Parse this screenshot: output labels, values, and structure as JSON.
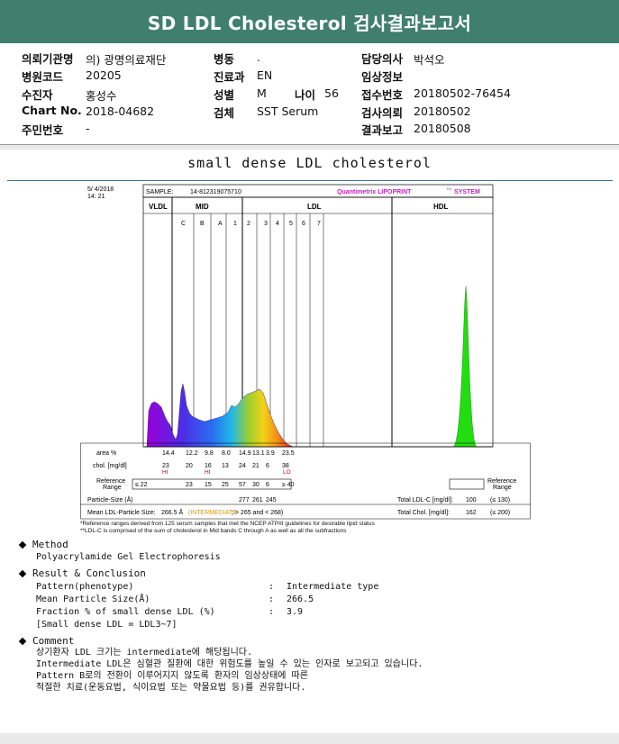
{
  "title": "SD LDL Cholesterol 검사결과보고서",
  "info": {
    "inst_label": "의뢰기관명",
    "inst_value": "의) 광명의료재단",
    "code_label": "병원코드",
    "code_value": "20205",
    "patient_label": "수진자",
    "patient_value": "홍성수",
    "chart_label": "Chart No.",
    "chart_value": "2018-04682",
    "id_label": "주민번호",
    "id_value": "-",
    "ward_label": "병동",
    "ward_value": ".",
    "dept_label": "진료과",
    "dept_value": "EN",
    "sex_label": "성별",
    "sex_value": "M",
    "age_label": "나이",
    "age_value": "56",
    "specimen_label": "검체",
    "specimen_value": "SST Serum",
    "doctor_label": "담당의사",
    "doctor_value": "박석오",
    "clinical_label": "임상정보",
    "clinical_value": "",
    "receipt_label": "접수번호",
    "receipt_value": "20180502-76454",
    "request_label": "검사의뢰",
    "request_value": "20180502",
    "result_label": "결과보고",
    "result_value": "20180508"
  },
  "section_title": "small dense LDL cholesterol",
  "chart_header": {
    "date": "5/ 4/2018",
    "time": "14: 21",
    "sample_label": "SAMPLE:",
    "sample_value": "14-812319075710",
    "system_a": "Quantimetrix LIPOPRINT",
    "system_tm": "TM",
    "system_b": "SYSTEM"
  },
  "chart_data": {
    "type": "area",
    "groups": [
      "VLDL",
      "MID",
      "LDL",
      "HDL"
    ],
    "bands": [
      "C",
      "B",
      "A",
      "1",
      "2",
      "3",
      "4",
      "5",
      "6",
      "7"
    ],
    "rows": {
      "area_label": "area %",
      "area": [
        "14.4",
        "12.2",
        "9.8",
        "8.0",
        "14.9",
        "13.1",
        "3.9",
        "23.5"
      ],
      "chol_label": "chol. [mg/dl]",
      "chol": [
        "23",
        "20",
        "16",
        "13",
        "24",
        "21",
        "6",
        "38"
      ],
      "flags": [
        "HI",
        "",
        "HI",
        "",
        "",
        "",
        "",
        "LO"
      ],
      "ref_label": "Reference Range",
      "ref": [
        "≤ 22",
        "23",
        "15",
        "25",
        "57",
        "30",
        "6",
        "≥ 40"
      ],
      "ref_label_right": "Reference Range"
    },
    "particle_size_label": "Particle-Size (Å)",
    "particle_size": [
      "277",
      "261",
      "245"
    ],
    "total_ldl_label": "Total LDL-C [mg/dl]:",
    "total_ldl_value": "100",
    "total_ldl_ref": "(≤ 130)",
    "mean_size_label": "Mean LDL-Particle Size:",
    "mean_size_value": "266.5 Å",
    "mean_size_class": "(INTERMEDIATE",
    "mean_size_rest": "; > 265 and < 268)",
    "total_chol_label": "Total Chol. [mg/dl]:",
    "total_chol_value": "162",
    "total_chol_ref": "(≤ 200)"
  },
  "notes": [
    "*Reference ranges derived from 125 serum samples that met the NCEP ATPIII guidelines for desirable lipid status",
    "**LDL-C is comprised of the sum of cholesterol in Mid bands C through A as well as all the subfractions"
  ],
  "method": {
    "heading": "Method",
    "text": "Polyacrylamide Gel Electrophoresis"
  },
  "result": {
    "heading": "Result & Conclusion",
    "items": [
      {
        "label": "Pattern(phenotype)",
        "sep": ":",
        "value": "Intermediate type"
      },
      {
        "label": "Mean Particle Size(Å)",
        "sep": ":",
        "value": "266.5"
      },
      {
        "label": "Fraction % of small dense LDL (%)",
        "sep": ":",
        "value": "3.9"
      }
    ],
    "note": "[Small dense LDL = LDL3~7]"
  },
  "comment": {
    "heading": "Comment",
    "lines": [
      "상기환자 LDL 크기는 intermediate에 해당됩니다.",
      "Intermediate LDL은 심혈관 질환에 대한 위험도를 높일 수 있는 인자로 보고되고 있습니다.",
      "Pattern B로의 전환이 이루어지지 않도록 환자의 임상상태에 따른",
      "적절한 치료(운동요법, 식이요법 또는 약물요법 등)를 권유합니다."
    ]
  }
}
